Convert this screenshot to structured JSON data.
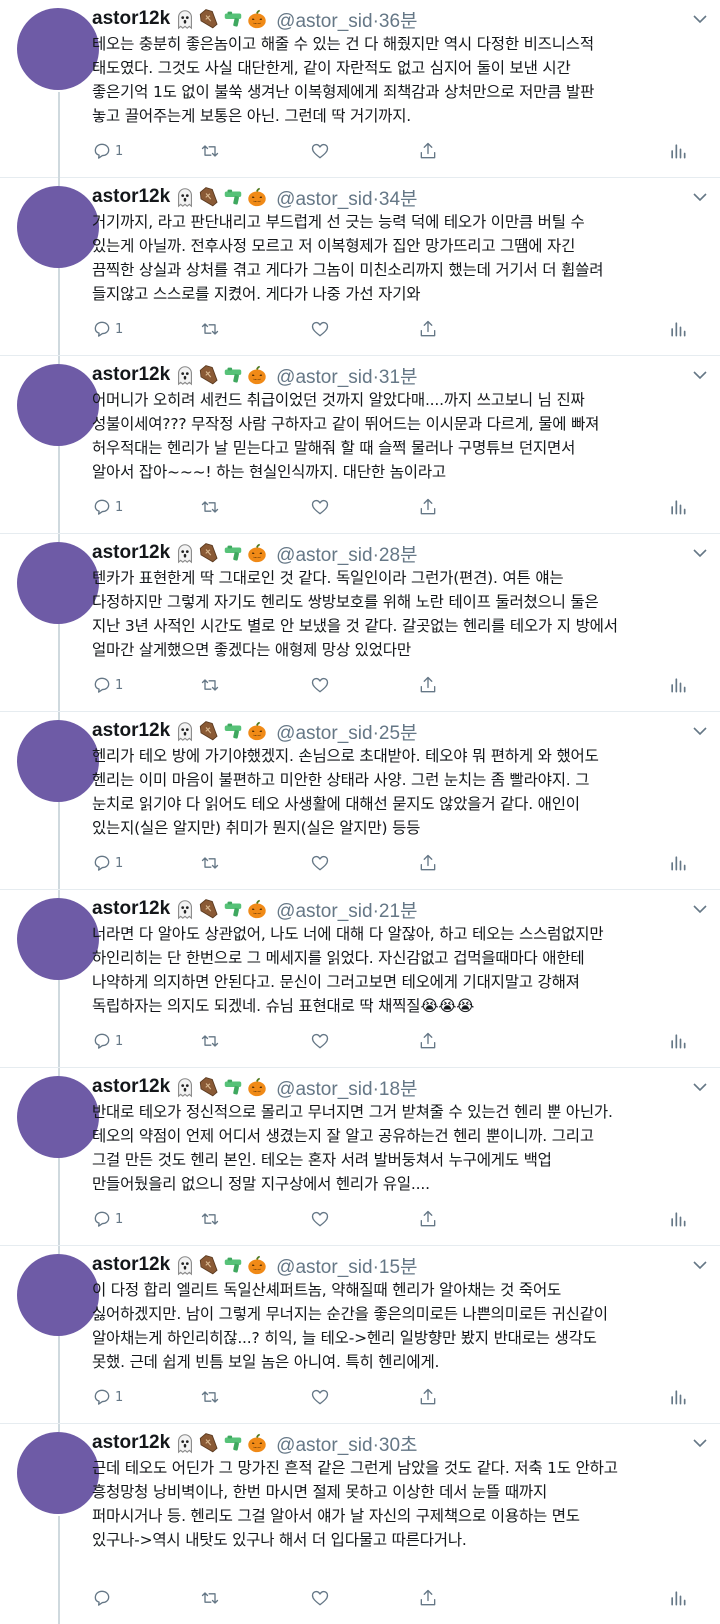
{
  "author": {
    "name": "astor12k",
    "handle": "@astor_sid",
    "separator": "·"
  },
  "emoji_icons": [
    "ghost-icon",
    "coffin-icon",
    "water-gun-icon",
    "pumpkin-icon"
  ],
  "tweets": [
    {
      "time": "36분",
      "text": "테오는 충분히 좋은놈이고 해줄 수 있는 건 다 해줬지만 역시 다정한 비즈니스적\n태도였다. 그것도 사실 대단한게, 같이 자란적도 없고 심지어 둘이 보낸 시간\n좋은기억 1도 없이 불쑥 생겨난 이복형제에게 죄책감과 상처만으로 저만큼 발판\n놓고 끌어주는게 보통은 아닌. 그런데 딱 거기까지.",
      "reply_count": "1"
    },
    {
      "time": "34분",
      "text": "거기까지, 라고 판단내리고 부드럽게 선 긋는 능력 덕에 테오가 이만큼 버틸 수\n있는게 아닐까. 전후사정 모르고 저 이복형제가 집안 망가뜨리고 그땜에 자긴\n끔찍한 상실과 상처를 겪고 게다가 그놈이 미친소리까지 했는데 거기서 더 휩쓸려\n들지않고 스스로를 지켰어. 게다가 나중 가선 자기와",
      "reply_count": "1"
    },
    {
      "time": "31분",
      "text": "어머니가 오히려 세컨드 취급이었던 것까지 알았다매....까지 쓰고보니 님 진짜\n성불이세여??? 무작정 사람 구하자고 같이 뛰어드는 이시문과 다르게, 물에 빠져\n허우적대는 헨리가 날 믿는다고 말해줘 할 때 슬쩍 물러나 구명튜브 던지면서\n알아서 잡아~~~! 하는 현실인식까지. 대단한 놈이라고",
      "reply_count": "1"
    },
    {
      "time": "28분",
      "text": "텐카가 표현한게 딱 그대로인 것 같다. 독일인이라 그런가(편견). 여튼 얘는\n다정하지만 그렇게 자기도 헨리도 쌍방보호를 위해 노란 테이프 둘러쳤으니 둘은\n지난 3년 사적인 시간도 별로 안 보냈을 것 같다. 갈곳없는 헨리를 테오가 지 방에서\n얼마간 살게했으면 좋겠다는 애형제 망상 있었다만",
      "reply_count": "1"
    },
    {
      "time": "25분",
      "text": "헨리가 테오 방에 가기야했겠지. 손님으로 초대받아. 테오야 뭐 편하게 와 했어도\n헨리는 이미 마음이 불편하고 미안한 상태라 사양. 그런 눈치는 좀 빨라야지. 그\n눈치로 읽기야 다 읽어도 테오 사생활에 대해선 묻지도 않았을거 같다. 애인이\n있는지(실은 알지만) 취미가 뭔지(실은 알지만) 등등",
      "reply_count": "1"
    },
    {
      "time": "21분",
      "text": "너라면 다 알아도 상관없어, 나도 너에 대해 다 알잖아, 하고 테오는 스스럼없지만\n하인리히는 단 한번으로 그 메세지를 읽었다. 자신감없고 겁먹을때마다 애한테\n나약하게 의지하면 안된다고. 문신이 그러고보면 테오에게 기대지말고 강해져\n독립하자는 의지도 되겠네. 슈님 표현대로 딱 채찍질😭😭😭",
      "reply_count": "1"
    },
    {
      "time": "18분",
      "text": "반대로 테오가 정신적으로 몰리고 무너지면 그거 받쳐줄 수 있는건 헨리 뿐 아닌가.\n테오의 약점이 언제 어디서 생겼는지 잘 알고 공유하는건 헨리 뿐이니까. 그리고\n그걸 만든 것도 헨리 본인. 테오는 혼자 서려 발버둥쳐서 누구에게도 백업\n만들어뒀을리 없으니 정말 지구상에서 헨리가 유일....",
      "reply_count": "1"
    },
    {
      "time": "15분",
      "text": "이 다정 합리 엘리트 독일산셰퍼트놈, 약해질때 헨리가 알아채는 것 죽어도\n싫어하겠지만. 남이 그렇게 무너지는 순간을 좋은의미로든 나쁜의미로든 귀신같이\n알아채는게 하인리히잖...? 히익, 늘 테오->헨리 일방향만 봤지 반대로는 생각도\n못했. 근데 쉽게 빈틈 보일 놈은 아니여. 특히 헨리에게.",
      "reply_count": "1"
    },
    {
      "time": "30초",
      "text": "근데 테오도 어딘가 그 망가진 흔적 같은 그런게 남았을 것도 같다. 저축 1도 안하고\n흥청망청 낭비벽이나, 한번 마시면 절제 못하고 이상한 데서 눈뜰 때까지\n퍼마시거나 등.  헨리도 그걸 알아서 얘가 날 자신의 구제책으로 이용하는 면도\n있구나->역시 내탓도 있구나 해서 더 입다물고 따른다거나.",
      "reply_count": ""
    }
  ]
}
